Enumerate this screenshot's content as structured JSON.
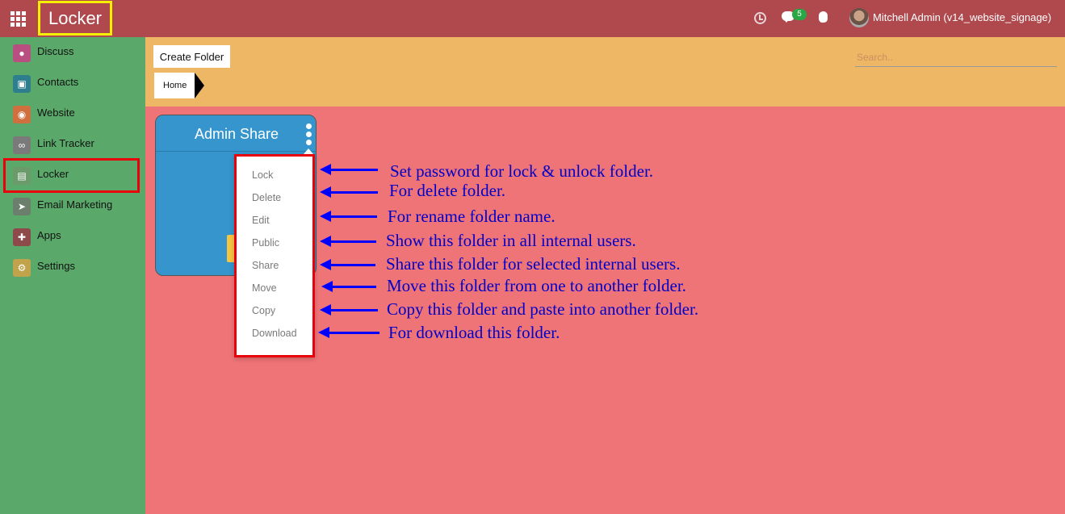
{
  "topbar": {
    "app_title": "Locker",
    "messages_badge": "5",
    "user": "Mitchell Admin (v14_website_signage)",
    "icons": [
      "apps-grid-icon",
      "clock-icon",
      "chat-icon",
      "bug-icon"
    ]
  },
  "sidebar": {
    "items": [
      {
        "label": "Discuss",
        "icon": "discuss-icon",
        "color": "#b84f80"
      },
      {
        "label": "Contacts",
        "icon": "contacts-icon",
        "color": "#2e7f8e"
      },
      {
        "label": "Website",
        "icon": "website-icon",
        "color": "#d1703f"
      },
      {
        "label": "Link Tracker",
        "icon": "link-tracker-icon",
        "color": "#7a7a7a"
      },
      {
        "label": "Locker",
        "icon": "locker-icon",
        "color": "#6b9b6b"
      },
      {
        "label": "Email Marketing",
        "icon": "email-marketing-icon",
        "color": "#6c7f6c"
      },
      {
        "label": "Apps",
        "icon": "apps-icon",
        "color": "#8e4a4a"
      },
      {
        "label": "Settings",
        "icon": "settings-icon",
        "color": "#c0a34a"
      }
    ],
    "active": "Locker"
  },
  "control_panel": {
    "create_button": "Create Folder",
    "breadcrumb": "Home",
    "search_placeholder": "Search.."
  },
  "folder": {
    "title": "Admin Share",
    "menu": [
      "Lock",
      "Delete",
      "Edit",
      "Public",
      "Share",
      "Move",
      "Copy",
      "Download"
    ]
  },
  "annotations": [
    "Set password for lock & unlock folder.",
    "For delete folder.",
    "For rename folder name.",
    "Show this folder in all internal users.",
    "Share this folder for selected internal users.",
    "Move this folder from one to another folder.",
    "Copy this folder and paste into another folder.",
    "For download this folder."
  ],
  "colors": {
    "topbar": "#b0494d",
    "sidebar": "#5aa96a",
    "control_panel": "#eeb766",
    "main": "#ef7477",
    "card": "#3595cc",
    "highlight": "#e8000b",
    "annotation": "#0000ff"
  }
}
